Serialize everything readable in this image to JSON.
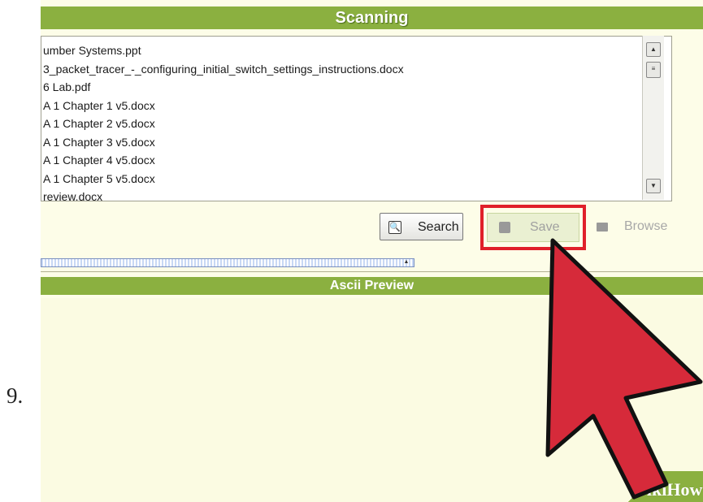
{
  "step": {
    "number": "9."
  },
  "scanning": {
    "title": "Scanning",
    "files": [
      "umber Systems.ppt",
      "3_packet_tracer_-_configuring_initial_switch_settings_instructions.docx",
      "6 Lab.pdf",
      "A 1 Chapter 1 v5.docx",
      "A 1 Chapter 2 v5.docx",
      "A 1 Chapter 3 v5.docx",
      "A 1 Chapter 4 v5.docx",
      "A 1 Chapter 5 v5.docx",
      "review.docx"
    ]
  },
  "toolbar": {
    "search_label": "Search",
    "save_label": "Save",
    "browse_label": "Browse"
  },
  "preview": {
    "title": "Ascii Preview"
  },
  "watermark": {
    "wiki": "wiki",
    "how": "How"
  },
  "colors": {
    "accent_green": "#8bb040",
    "highlight_red": "#e0202a",
    "arrow_red": "#d62a3a"
  },
  "icons": {
    "search": "search-icon",
    "save": "save-disk-icon",
    "browse": "folder-icon",
    "pointer": "cursor-arrow-icon"
  }
}
